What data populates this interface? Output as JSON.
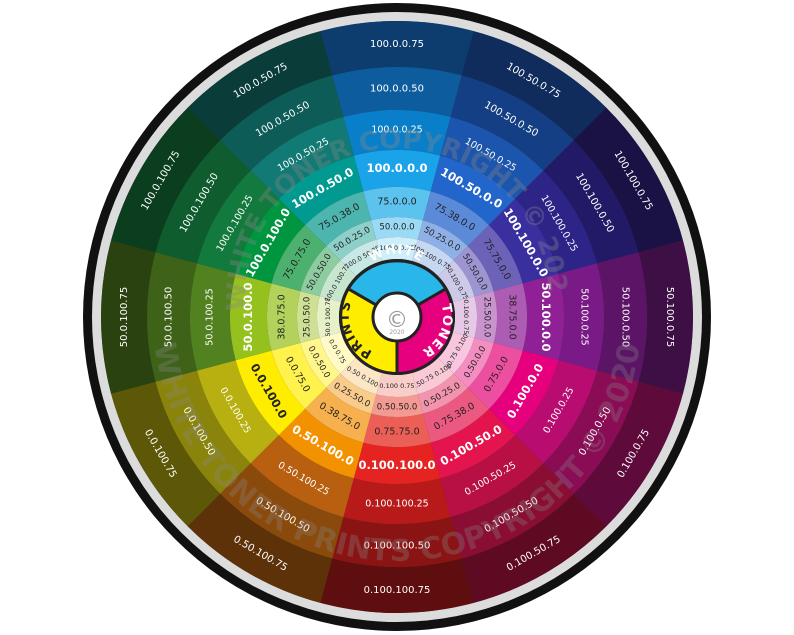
{
  "watermark": {
    "text_top": "WHITE TONER COPYRIGHT © 2020",
    "text_bottom": "WHITE TONER PRINTS COPYRIGHT © 2020",
    "color": "#888888"
  },
  "hub": {
    "labels": [
      "WHITE",
      "TONER",
      "PRINTS"
    ],
    "colors": [
      "#29b6e8",
      "#e6007e",
      "#ffed00"
    ],
    "center_symbol": "©",
    "center_year": "2020"
  },
  "wheel": {
    "segments": [
      {
        "hue": "cyan",
        "labels": [
          "100.0.0.75",
          "100.0.0.50",
          "100.0.0.25",
          "100.0.0.0",
          "75.0.0.0",
          "50.0.0.0",
          "100.0 0.75"
        ],
        "colors": [
          "#0d3d6e",
          "#0d5c9e",
          "#0a7fc9",
          "#1aa3e8",
          "#5cc3ef",
          "#9bdaf5",
          "#cdeefa"
        ]
      },
      {
        "hue": "azure",
        "labels": [
          "100.50.0.75",
          "100.50.0.50",
          "100.50.0.25",
          "100.50.0.0",
          "75.38.0.0",
          "50.25.0.0",
          "100.100 0.75"
        ],
        "colors": [
          "#0f2c5c",
          "#153f85",
          "#1b55ad",
          "#2266cc",
          "#5b8ad9",
          "#8fb0e6",
          "#c6d7f2"
        ]
      },
      {
        "hue": "blue",
        "labels": [
          "100.100.0.75",
          "100.100.0.50",
          "100.100.0.25",
          "100.100.0.0",
          "75.75.0.0",
          "50.50.0.0",
          "50.100 0.75"
        ],
        "colors": [
          "#1a1145",
          "#221a66",
          "#2d2488",
          "#3a2f9e",
          "#6c62b8",
          "#9c95d1",
          "#cdc9e9"
        ]
      },
      {
        "hue": "violet",
        "labels": [
          "50.100.0.75",
          "50.100.0.50",
          "50.100.0.25",
          "50.100.0.0",
          "38.75.0.0",
          "25.50.0.0",
          "0.100 0.75"
        ],
        "colors": [
          "#3d0f45",
          "#5c1466",
          "#7a1a86",
          "#8f2096",
          "#ad5cb3",
          "#c994cd",
          "#e5c9e6"
        ]
      },
      {
        "hue": "magenta",
        "labels": [
          "0.100.0.75",
          "0.100.0.50",
          "0.100.0.25",
          "0.100.0.0",
          "0.75.0.0",
          "0.50.0.0",
          "50.75 0.100"
        ],
        "colors": [
          "#5e0a3a",
          "#8a0c55",
          "#b80c70",
          "#e6007e",
          "#ed4fa0",
          "#f48dc0",
          "#f9c6e0"
        ]
      },
      {
        "hue": "rose",
        "labels": [
          "0.100.50.75",
          "0.100.50.50",
          "0.100.50.25",
          "0.100.50.0",
          "0.75.38.0",
          "0.50.25.0",
          "0.50.75 0.100"
        ],
        "colors": [
          "#5e0a22",
          "#8a0d33",
          "#b80f44",
          "#e4144f",
          "#eb5880",
          "#f294ad",
          "#f9c9d6"
        ]
      },
      {
        "hue": "red",
        "labels": [
          "0.100.100.75",
          "0.100.100.50",
          "0.100.100.25",
          "0.100.100.0",
          "0.75.75.0",
          "0.50.50.0",
          "0.100 0.75"
        ],
        "colors": [
          "#5e0e0e",
          "#8a1414",
          "#b81a1a",
          "#e52421",
          "#ec5f57",
          "#f39a92",
          "#f9cdc8"
        ]
      },
      {
        "hue": "orange",
        "labels": [
          "0.50.100.75",
          "0.50.100.50",
          "0.50.100.25",
          "0.50.100.0",
          "0.38.75.0",
          "0.25.50.0",
          "0.50 0.100"
        ],
        "colors": [
          "#5e3208",
          "#8a4a0c",
          "#b86010",
          "#f39200",
          "#f6b04d",
          "#f9cc8c",
          "#fce6c6"
        ]
      },
      {
        "hue": "yellow",
        "labels": [
          "0.0.100.75",
          "0.0.100.50",
          "0.0.100.25",
          "0.0.100.0",
          "0.0.75.0",
          "0.0.50.0",
          "0.0 0.75"
        ],
        "colors": [
          "#5c5808",
          "#8a840c",
          "#b8b010",
          "#ffed00",
          "#fff24d",
          "#fff68c",
          "#fffac6"
        ]
      },
      {
        "hue": "chartreuse",
        "labels": [
          "50.0.100.75",
          "50.0.100.50",
          "50.0.100.25",
          "50.0.100.0",
          "38.0.75.0",
          "25.0.50.0",
          "50.0 100.75"
        ],
        "colors": [
          "#2a4210",
          "#3e6218",
          "#528220",
          "#95c11f",
          "#b2d25c",
          "#cde094",
          "#e6f0c9"
        ]
      },
      {
        "hue": "green",
        "labels": [
          "100.0.100.75",
          "100.0.100.50",
          "100.0.100.25",
          "100.0.100.0",
          "75.0.75.0",
          "50.0.50.0",
          "100.0 100.75"
        ],
        "colors": [
          "#0b3d1f",
          "#0f5c2e",
          "#137a3d",
          "#009640",
          "#4cb16f",
          "#8dcc9f",
          "#c7e6cf"
        ]
      },
      {
        "hue": "teal",
        "labels": [
          "100.0.50.75",
          "100.0.50.50",
          "100.0.50.25",
          "100.0.50.0",
          "75.0.38.0",
          "50.0.25.0",
          "100.0 50.75"
        ],
        "colors": [
          "#0a3d3a",
          "#0d5c57",
          "#117a74",
          "#009a90",
          "#4cb5ad",
          "#8dd0ca",
          "#c7e8e4"
        ]
      }
    ]
  }
}
